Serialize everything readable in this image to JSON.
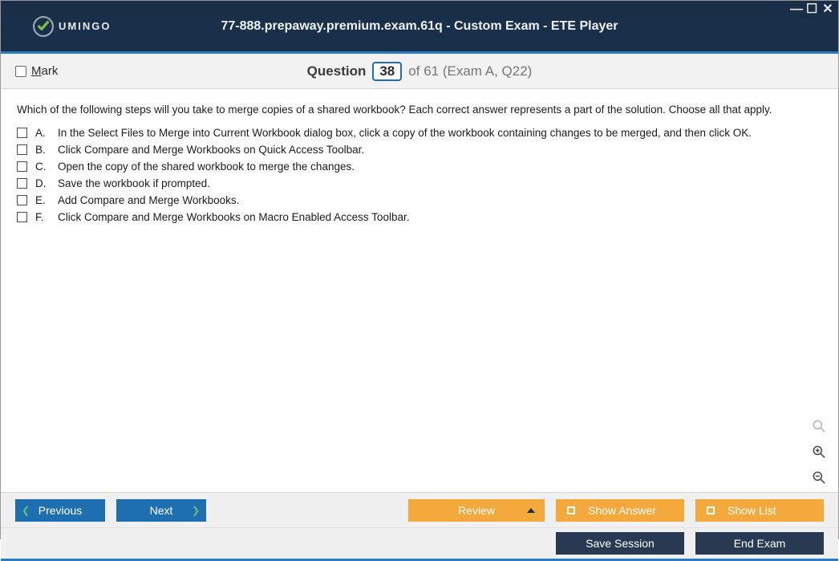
{
  "logo": {
    "text": "UMINGO"
  },
  "window": {
    "title": "77-888.prepaway.premium.exam.61q - Custom Exam - ETE Player"
  },
  "header": {
    "mark_letter": "M",
    "mark_rest": "ark",
    "question_word": "Question",
    "current": "38",
    "of_word": "of",
    "total": "61",
    "suffix": "(Exam A, Q22)"
  },
  "question": {
    "text": "Which of the following steps will you take to merge copies of a shared workbook? Each correct answer represents a part of the solution. Choose all that apply.",
    "options": [
      {
        "letter": "A.",
        "text": "In the Select Files to Merge into Current Workbook dialog box, click a copy of the workbook containing changes to be merged, and then click OK."
      },
      {
        "letter": "B.",
        "text": "Click Compare and Merge Workbooks on Quick Access Toolbar."
      },
      {
        "letter": "C.",
        "text": "Open the copy of the shared workbook to merge the changes."
      },
      {
        "letter": "D.",
        "text": "Save the workbook if prompted."
      },
      {
        "letter": "E.",
        "text": "Add Compare and Merge Workbooks."
      },
      {
        "letter": "F.",
        "text": "Click Compare and Merge Workbooks on Macro Enabled Access Toolbar."
      }
    ]
  },
  "footer": {
    "previous": "Previous",
    "next": "Next",
    "review": "Review",
    "show_answer": "Show Answer",
    "show_list": "Show List",
    "save_session": "Save Session",
    "end_exam": "End Exam"
  }
}
